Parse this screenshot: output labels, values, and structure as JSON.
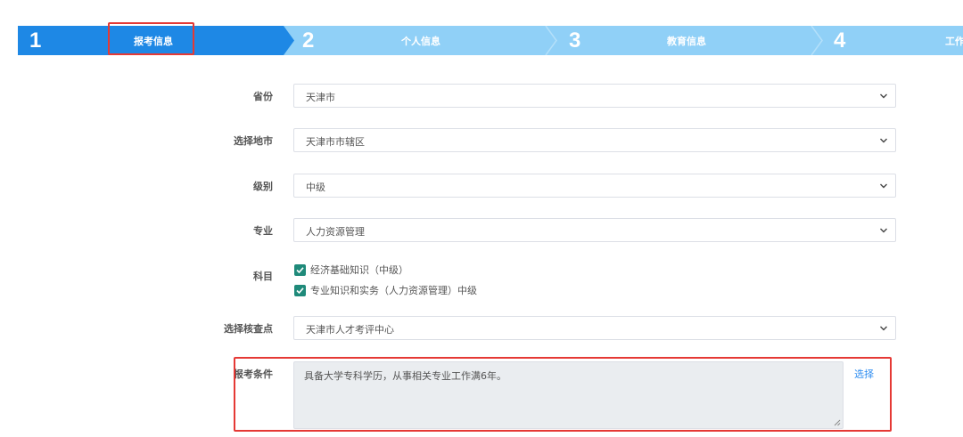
{
  "steps": [
    {
      "number": "1",
      "label": "报考信息"
    },
    {
      "number": "2",
      "label": "个人信息"
    },
    {
      "number": "3",
      "label": "教育信息"
    },
    {
      "number": "4",
      "label": "工作"
    }
  ],
  "form": {
    "province": {
      "label": "省份",
      "value": "天津市"
    },
    "city": {
      "label": "选择地市",
      "value": "天津市市辖区"
    },
    "level": {
      "label": "级别",
      "value": "中级"
    },
    "major": {
      "label": "专业",
      "value": "人力资源管理"
    },
    "subjects": {
      "label": "科目",
      "items": [
        "经济基础知识（中级）",
        "专业知识和实务（人力资源管理）中级"
      ]
    },
    "checkpoint": {
      "label": "选择核查点",
      "value": "天津市人才考评中心"
    },
    "condition": {
      "label": "报考条件",
      "value": "具备大学专科学历，从事相关专业工作满6年。",
      "action": "选择"
    }
  },
  "colors": {
    "active_step": "#1e88e5",
    "inactive_step": "#90d0f7",
    "checkbox": "#1f8a7a",
    "highlight": "#e53935",
    "link": "#2d8cf0"
  }
}
